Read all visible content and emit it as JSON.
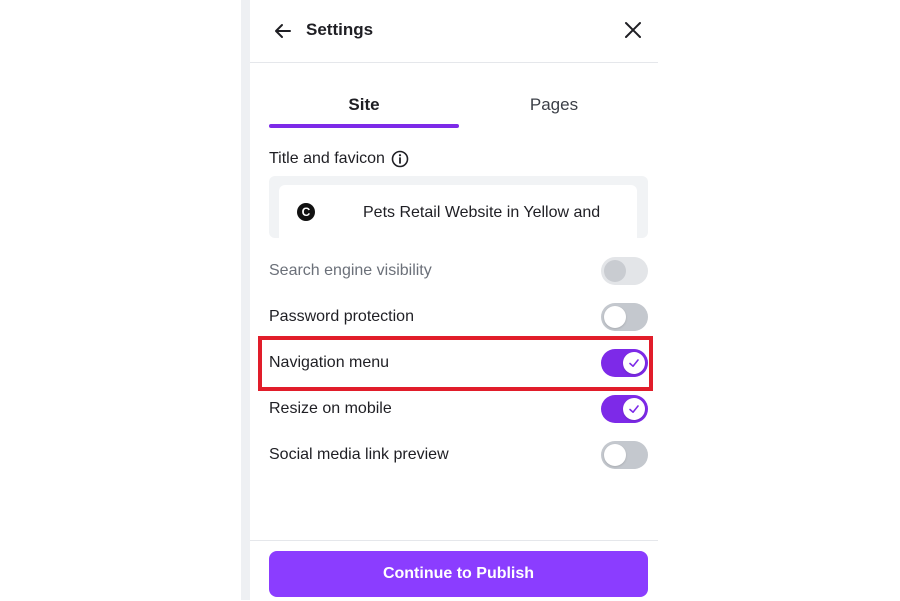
{
  "header": {
    "title": "Settings",
    "back_icon": "arrow-left-icon",
    "close_icon": "close-icon"
  },
  "tabs": [
    {
      "label": "Site",
      "active": true
    },
    {
      "label": "Pages",
      "active": false
    }
  ],
  "title_favicon": {
    "label": "Title and favicon",
    "info_icon": "info-icon",
    "favicon_glyph": "C",
    "value": "Pets Retail Website in Yellow and"
  },
  "settings": {
    "search_engine": {
      "label": "Search engine visibility",
      "state": "off-disabled"
    },
    "password": {
      "label": "Password protection",
      "state": "off"
    },
    "navigation": {
      "label": "Navigation menu",
      "state": "on"
    },
    "resize_mobile": {
      "label": "Resize on mobile",
      "state": "on"
    },
    "social_preview": {
      "label": "Social media link preview",
      "state": "off"
    }
  },
  "footer": {
    "publish_label": "Continue to Publish"
  },
  "colors": {
    "accent": "#7d2ae8",
    "button": "#8b3dff",
    "highlight": "#e11d2a"
  }
}
